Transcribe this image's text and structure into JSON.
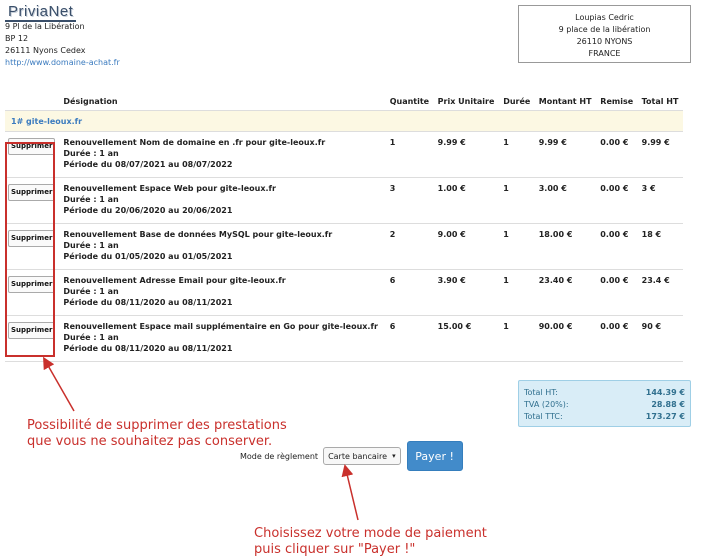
{
  "brand": {
    "logo": "PriviaNet"
  },
  "company": {
    "line1": "9 Pl de la Libération",
    "line2": "BP 12",
    "line3": "26111 Nyons Cedex",
    "url": "http://www.domaine-achat.fr"
  },
  "client": {
    "name": "Loupias Cedric",
    "street": "9 place de la libération",
    "city": "26110 NYONS",
    "country": "FRANCE"
  },
  "table": {
    "headers": {
      "designation": "Désignation",
      "quantity": "Quantite",
      "unit_price": "Prix Unitaire",
      "duration": "Durée",
      "amount": "Montant HT",
      "discount": "Remise",
      "total": "Total HT"
    },
    "group_label": "1# gite-leoux.fr",
    "delete_label": "Supprimer",
    "rows": [
      {
        "title": "Renouvellement Nom de domaine en .fr pour gite-leoux.fr",
        "duration_text": "Durée : 1 an",
        "period": "Période du 08/07/2021 au 08/07/2022",
        "qty": "1",
        "unit": "9.99 €",
        "dur": "1",
        "amount": "9.99 €",
        "discount": "0.00 €",
        "total": "9.99 €"
      },
      {
        "title": "Renouvellement Espace Web pour gite-leoux.fr",
        "duration_text": "Durée : 1 an",
        "period": "Période du 20/06/2020 au 20/06/2021",
        "qty": "3",
        "unit": "1.00 €",
        "dur": "1",
        "amount": "3.00 €",
        "discount": "0.00 €",
        "total": "3 €"
      },
      {
        "title": "Renouvellement Base de données MySQL pour gite-leoux.fr",
        "duration_text": "Durée : 1 an",
        "period": "Période du 01/05/2020 au 01/05/2021",
        "qty": "2",
        "unit": "9.00 €",
        "dur": "1",
        "amount": "18.00 €",
        "discount": "0.00 €",
        "total": "18 €"
      },
      {
        "title": "Renouvellement Adresse Email pour gite-leoux.fr",
        "duration_text": "Durée : 1 an",
        "period": "Période du 08/11/2020 au 08/11/2021",
        "qty": "6",
        "unit": "3.90 €",
        "dur": "1",
        "amount": "23.40 €",
        "discount": "0.00 €",
        "total": "23.4 €"
      },
      {
        "title": "Renouvellement Espace mail supplémentaire en Go pour gite-leoux.fr",
        "duration_text": "Durée : 1 an",
        "period": "Période du 08/11/2020 au 08/11/2021",
        "qty": "6",
        "unit": "15.00 €",
        "dur": "1",
        "amount": "90.00 €",
        "discount": "0.00 €",
        "total": "90 €"
      }
    ]
  },
  "totals": {
    "ht_label": "Total HT:",
    "ht_value": "144.39 €",
    "tva_label": "TVA (20%):",
    "tva_value": "28.88 €",
    "ttc_label": "Total TTC:",
    "ttc_value": "173.27 €"
  },
  "payment": {
    "label": "Mode de règlement",
    "selected": "Carte bancaire",
    "pay_button": "Payer !"
  },
  "annotations": {
    "delete_line1": "Possibilité de supprimer des prestations",
    "delete_line2": "que vous ne souhaitez pas conserver.",
    "pay_line1": "Choisissez votre mode de paiement",
    "pay_line2": "puis cliquer sur \"Payer !\"",
    "color": "#c9302c"
  }
}
